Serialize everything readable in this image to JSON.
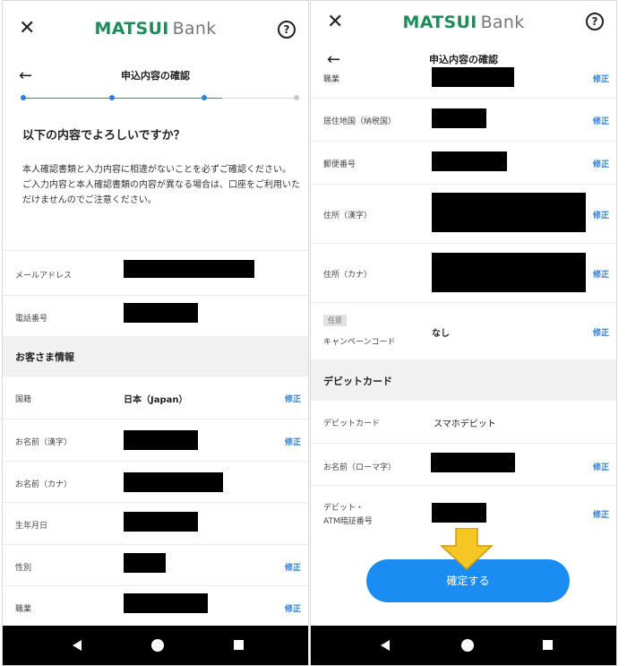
{
  "brand": {
    "name_bold": "MATSUI",
    "name_light": "Bank"
  },
  "header": {
    "title": "申込内容の確認"
  },
  "left": {
    "heading": "以下の内容でよろしいですか？",
    "note": "本人確認書類と入力内容に相違がないことを必ずご確認ください。\nご入力内容と本人確認書類の内容が異なる場合は、口座をご利用いただけませんのでご注意ください。",
    "contact_rows": [
      {
        "label": "メールアドレス"
      },
      {
        "label": "電話番号"
      }
    ],
    "section_customer": "お客さま情報",
    "customer_rows": [
      {
        "label": "国籍",
        "value": "日本（Japan）",
        "edit": "修正"
      },
      {
        "label": "お名前（漢字）",
        "edit": "修正"
      },
      {
        "label": "お名前（カナ）"
      },
      {
        "label": "生年月日"
      },
      {
        "label": "性別",
        "edit": "修正"
      },
      {
        "label": "職業",
        "edit": "修正"
      }
    ]
  },
  "right": {
    "rows": [
      {
        "label": "職業",
        "edit": "修正"
      },
      {
        "label": "居住地国（納税国）",
        "edit": "修正"
      },
      {
        "label": "郵便番号",
        "edit": "修正"
      },
      {
        "label": "住所（漢字）",
        "edit": "修正"
      },
      {
        "label": "住所（カナ）",
        "edit": "修正"
      },
      {
        "badge": "任意",
        "label": "キャンペーンコード",
        "value": "なし",
        "edit": "修正"
      }
    ],
    "section_debit": "デビットカード",
    "debit_rows": [
      {
        "label": "デビットカード",
        "value": "スマホデビット"
      },
      {
        "label": "お名前（ローマ字）",
        "edit": "修正"
      },
      {
        "label_line1": "デビット・",
        "label_line2": "ATM暗証番号",
        "edit": "修正"
      }
    ],
    "confirm_button": "確定する"
  },
  "colors": {
    "brand_green": "#1f8a5a",
    "accent_blue": "#2a7fe0",
    "button_blue": "#1a8cf2",
    "arrow_yellow": "#f6c624"
  },
  "icons": [
    "close-icon",
    "help-icon",
    "back-arrow-icon",
    "nav-back-icon",
    "nav-home-icon",
    "nav-recents-icon",
    "down-arrow-icon"
  ]
}
